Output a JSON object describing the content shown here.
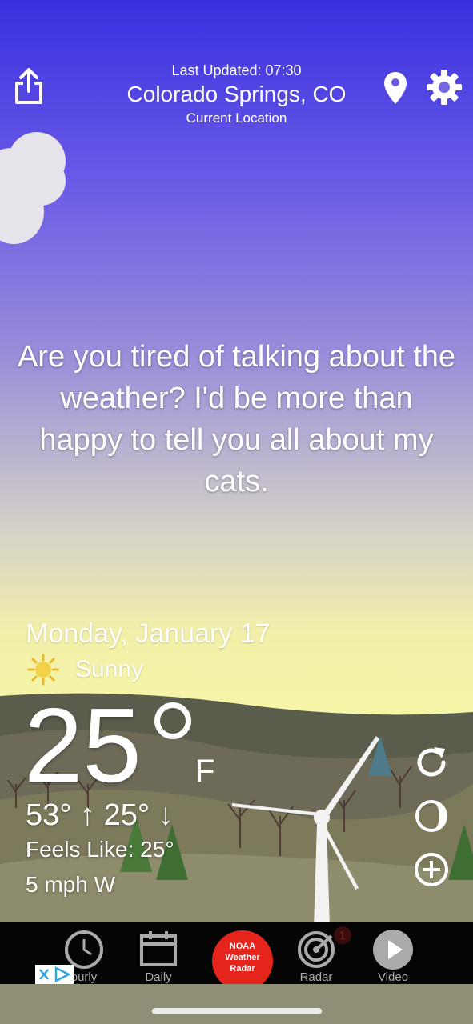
{
  "header": {
    "last_updated": "Last Updated: 07:30",
    "city": "Colorado Springs, CO",
    "location_label": "Current Location"
  },
  "message": "Are you tired of talking about the weather? I'd be more than happy to tell you all about my cats.",
  "weather": {
    "date": "Monday, January 17",
    "condition": "Sunny",
    "temperature": "25",
    "unit": "F",
    "high_low": "53° ↑ 25° ↓",
    "feels_like": "Feels Like: 25°",
    "wind": "5 mph W"
  },
  "tabs": [
    {
      "label": "ourly",
      "icon": "clock-icon"
    },
    {
      "label": "Daily",
      "icon": "calendar-icon"
    },
    {
      "label": "NOAA Weather Radar",
      "icon": "noaa-badge"
    },
    {
      "label": "Radar",
      "icon": "radar-icon"
    },
    {
      "label": "Video",
      "icon": "play-icon"
    }
  ],
  "radar_badge": "1",
  "colors": {
    "sky_top": "#3a2fe0",
    "sky_bottom": "#f6f6a8",
    "noaa_red": "#e5251c",
    "tabbar": "#050505"
  }
}
